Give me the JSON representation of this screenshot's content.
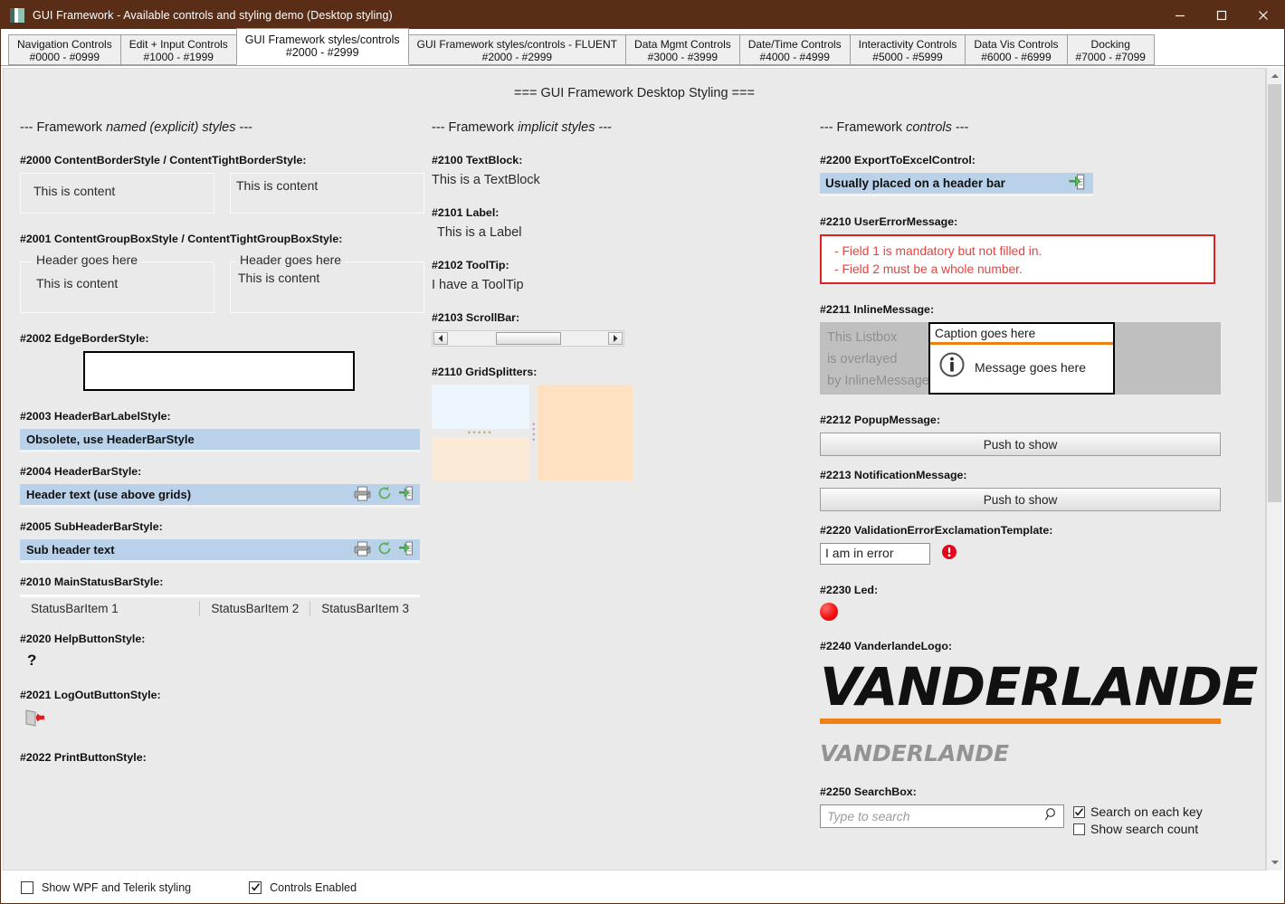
{
  "window": {
    "title": "GUI Framework - Available controls and styling demo (Desktop styling)",
    "icon": "app-icon",
    "minimize": "minimize-icon",
    "maximize": "maximize-icon",
    "close": "close-icon"
  },
  "tabs": [
    {
      "line1": "Navigation Controls",
      "line2": "#0000 - #0999",
      "selected": false
    },
    {
      "line1": "Edit + Input Controls",
      "line2": "#1000 - #1999",
      "selected": false
    },
    {
      "line1": "GUI Framework styles/controls",
      "line2": "#2000 - #2999",
      "selected": true
    },
    {
      "line1": "GUI Framework styles/controls - FLUENT",
      "line2": "#2000 - #2999",
      "selected": false
    },
    {
      "line1": "Data Mgmt Controls",
      "line2": "#3000 - #3999",
      "selected": false
    },
    {
      "line1": "Date/Time Controls",
      "line2": "#4000 - #4999",
      "selected": false
    },
    {
      "line1": "Interactivity Controls",
      "line2": "#5000 - #5999",
      "selected": false
    },
    {
      "line1": "Data Vis Controls",
      "line2": "#6000 - #6999",
      "selected": false
    },
    {
      "line1": "Docking",
      "line2": "#7000 - #7099",
      "selected": false
    }
  ],
  "page_title": "=== GUI Framework Desktop Styling ===",
  "left": {
    "heading_a": "--- Framework ",
    "heading_b": "named (explicit) styles",
    "heading_c": " ---",
    "s2000": {
      "label": "#2000 ContentBorderStyle / ContentTightBorderStyle:",
      "box1_text": "This is content",
      "box2_text": "This is content"
    },
    "s2001": {
      "label": "#2001 ContentGroupBoxStyle / ContentTightGroupBoxStyle:",
      "box1_header": "Header goes here",
      "box1_text": "This is content",
      "box2_header": "Header goes here",
      "box2_text": "This is content"
    },
    "s2002": {
      "label": "#2002 EdgeBorderStyle:"
    },
    "s2003": {
      "label": "#2003 HeaderBarLabelStyle:",
      "bar_text": "Obsolete, use HeaderBarStyle"
    },
    "s2004": {
      "label": "#2004 HeaderBarStyle:",
      "bar_text": "Header text (use above grids)"
    },
    "s2005": {
      "label": "#2005 SubHeaderBarStyle:",
      "bar_text": "Sub header text"
    },
    "s2010": {
      "label": "#2010 MainStatusBarStyle:",
      "items": [
        "StatusBarItem 1",
        "StatusBarItem 2",
        "StatusBarItem 3"
      ]
    },
    "s2020": {
      "label": "#2020 HelpButtonStyle:",
      "glyph": "?"
    },
    "s2021": {
      "label": "#2021 LogOutButtonStyle:"
    },
    "s2022": {
      "label": "#2022 PrintButtonStyle:"
    }
  },
  "mid": {
    "heading_a": "--- Framework ",
    "heading_b": "implicit styles",
    "heading_c": " ---",
    "s2100": {
      "label": "#2100 TextBlock:",
      "text": "This is a TextBlock"
    },
    "s2101": {
      "label": "#2101 Label:",
      "text": "This is a Label"
    },
    "s2102": {
      "label": "#2102 ToolTip:",
      "text": "I have a ToolTip"
    },
    "s2103": {
      "label": "#2103 ScrollBar:"
    },
    "s2110": {
      "label": "#2110 GridSplitters:"
    }
  },
  "right": {
    "heading_a": "--- Framework ",
    "heading_b": "controls",
    "heading_c": " ---",
    "s2200": {
      "label": "#2200 ExportToExcelControl:",
      "bar_text": "Usually placed on a header bar"
    },
    "s2210": {
      "label": "#2210 UserErrorMessage:",
      "lines": [
        "- Field 1 is mandatory but not filled in.",
        "- Field 2 must be a whole number."
      ]
    },
    "s2211": {
      "label": "#2211 InlineMessage:",
      "listbox_lines": [
        "This Listbox",
        "is overlayed",
        "by InlineMessage"
      ],
      "caption": "Caption goes here",
      "message": "Message goes here"
    },
    "s2212": {
      "label": "#2212 PopupMessage:",
      "button": "Push to show"
    },
    "s2213": {
      "label": "#2213 NotificationMessage:",
      "button": "Push to show"
    },
    "s2220": {
      "label": "#2220 ValidationErrorExclamationTemplate:",
      "value": "I am in error"
    },
    "s2230": {
      "label": "#2230 Led:"
    },
    "s2240": {
      "label": "#2240 VanderlandeLogo:",
      "logo_big": "VANDERLANDE",
      "logo_small": "VANDERLANDE"
    },
    "s2250": {
      "label": "#2250 SearchBox:",
      "placeholder": "Type to search",
      "cb1": "Search on each key",
      "cb2": "Show search count"
    }
  },
  "footer": {
    "cb1": "Show WPF and Telerik styling",
    "cb1_checked": false,
    "cb2": "Controls Enabled",
    "cb2_checked": true
  },
  "colors": {
    "titlebar": "#5a2d16",
    "header_bar": "#b9d2ea",
    "content_bg": "#eaeaea",
    "accent_orange": "#ee8014",
    "error_red": "#e02020",
    "led_red": "#f21212"
  }
}
